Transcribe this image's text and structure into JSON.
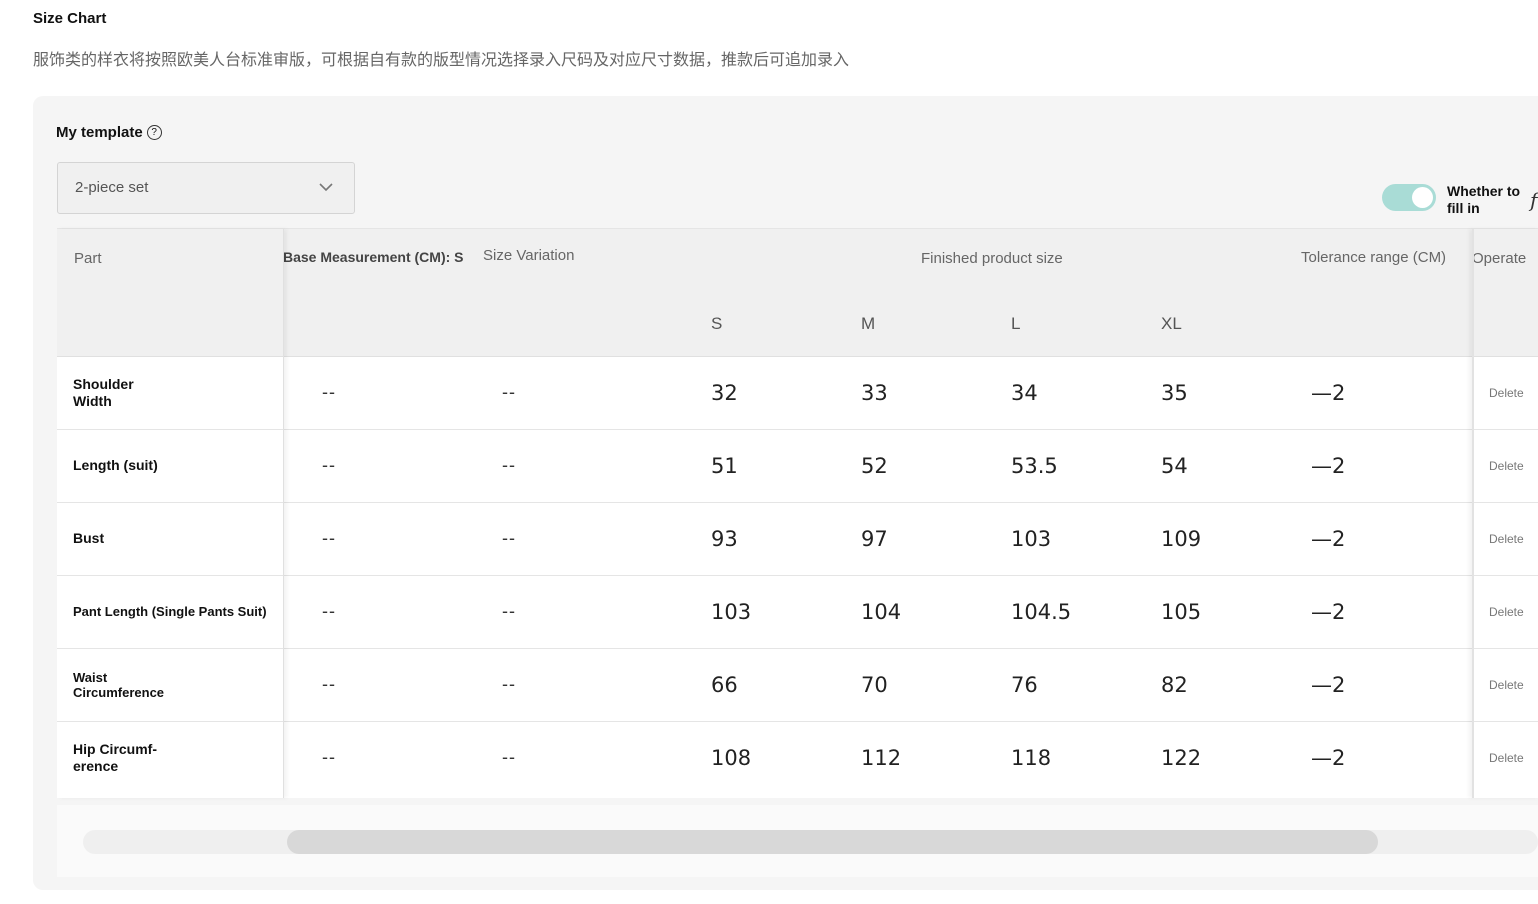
{
  "page": {
    "title": "Size Chart",
    "description": "服饰类的样衣将按照欧美人台标准审版，可根据自有款的版型情况选择录入尺码及对应尺寸数据，推款后可追加录入"
  },
  "template": {
    "label": "My template",
    "help_icon": "?",
    "selected": "2-piece set"
  },
  "toggle": {
    "label": "Whether to fill in",
    "on": true,
    "clipped_glyph": "f"
  },
  "table": {
    "headers": {
      "part": "Part",
      "base": "Base Measurement (CM): S",
      "variation": "Size Variation",
      "finished": "Finished product size",
      "tolerance": "Tolerance range (CM)",
      "operate": "Operate"
    },
    "sizes": [
      "S",
      "M",
      "L",
      "XL"
    ],
    "rows": [
      {
        "part": "Shoulder Width",
        "base": "--",
        "variation": "--",
        "values": [
          "32",
          "33",
          "34",
          "35"
        ],
        "tolerance": "—2",
        "action": "Delete"
      },
      {
        "part": "Length (suit)",
        "base": "--",
        "variation": "--",
        "values": [
          "51",
          "52",
          "53.5",
          "54"
        ],
        "tolerance": "—2",
        "action": "Delete"
      },
      {
        "part": "Bust",
        "base": "--",
        "variation": "--",
        "values": [
          "93",
          "97",
          "103",
          "109"
        ],
        "tolerance": "—2",
        "action": "Delete"
      },
      {
        "part": "Pant Length (Single Pants Suit)",
        "base": "--",
        "variation": "--",
        "values": [
          "103",
          "104",
          "104.5",
          "105"
        ],
        "tolerance": "—2",
        "action": "Delete"
      },
      {
        "part": "Waist Circumference",
        "base": "--",
        "variation": "--",
        "values": [
          "66",
          "70",
          "76",
          "82"
        ],
        "tolerance": "—2",
        "action": "Delete"
      },
      {
        "part": "Hip Circumf-erence",
        "base": "--",
        "variation": "--",
        "values": [
          "108",
          "112",
          "118",
          "122"
        ],
        "tolerance": "—2",
        "action": "Delete"
      }
    ]
  },
  "scrollbar": {
    "position_fraction": 0.14,
    "visible_fraction": 0.75
  }
}
